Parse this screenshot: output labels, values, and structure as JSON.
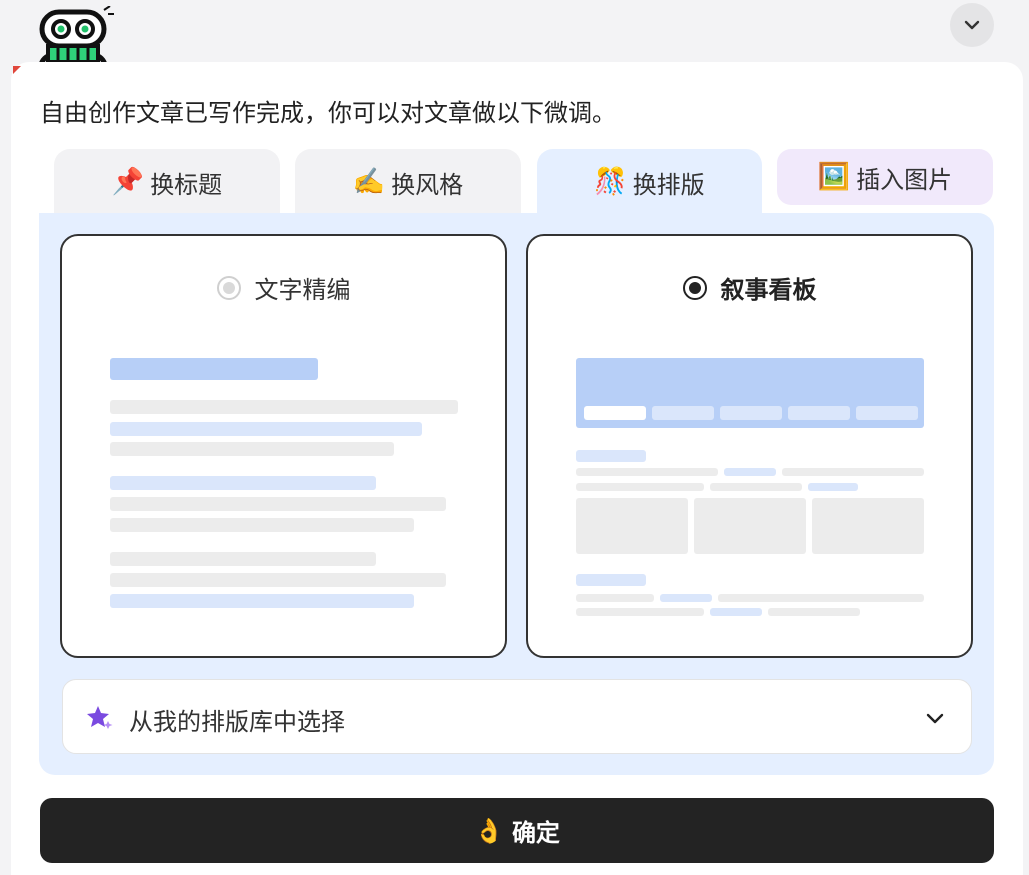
{
  "header": {
    "avatar_icon": "robot-icon",
    "collapse_icon": "chevron-down-icon"
  },
  "message": {
    "intro": "自由创作文章已写作完成，你可以对文章做以下微调。"
  },
  "tabs": [
    {
      "emoji": "📌",
      "label": "换标题",
      "icon": "pushpin-icon",
      "active": false
    },
    {
      "emoji": "✍️",
      "label": "换风格",
      "icon": "writing-hand-icon",
      "active": false
    },
    {
      "emoji": "🎊",
      "label": "换排版",
      "icon": "confetti-icon",
      "active": true
    },
    {
      "emoji": "🖼️",
      "label": "插入图片",
      "icon": "picture-icon",
      "active": false
    }
  ],
  "layout_options": [
    {
      "label": "文字精编",
      "selected": false
    },
    {
      "label": "叙事看板",
      "selected": true
    }
  ],
  "library": {
    "label": "从我的排版库中选择",
    "icon": "sparkle-star-icon",
    "chevron_icon": "chevron-down-icon"
  },
  "confirm": {
    "emoji": "👌",
    "label": "确定"
  },
  "colors": {
    "panel_bg": "#e5efff",
    "accent_blue": "#b7cff7",
    "confirm_bg": "#232323",
    "image_tab_bg": "#f1e9fb",
    "star_purple": "#7a4ae0"
  }
}
